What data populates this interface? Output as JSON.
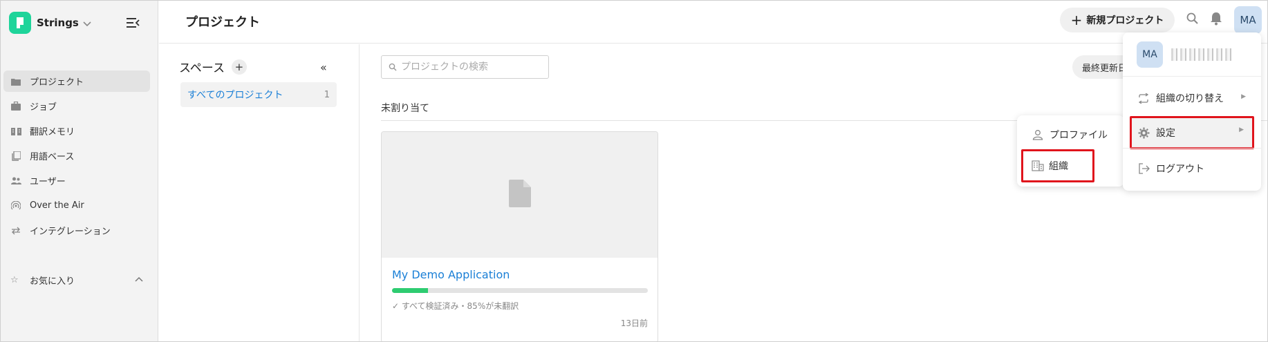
{
  "app": {
    "name": "Strings"
  },
  "sidebar": {
    "items": [
      {
        "label": "プロジェクト",
        "icon": "folder-icon",
        "active": true
      },
      {
        "label": "ジョブ",
        "icon": "briefcase-icon",
        "active": false
      },
      {
        "label": "翻訳メモリ",
        "icon": "book-icon",
        "active": false
      },
      {
        "label": "用語ベース",
        "icon": "glossary-icon",
        "active": false
      },
      {
        "label": "ユーザー",
        "icon": "users-icon",
        "active": false
      },
      {
        "label": "Over the Air",
        "icon": "broadcast-icon",
        "active": false
      },
      {
        "label": "インテグレーション",
        "icon": "arrows-icon",
        "active": false
      }
    ],
    "favorites": "お気に入り"
  },
  "header": {
    "title": "プロジェクト",
    "new_project": "新規プロジェクト",
    "avatar": "MA"
  },
  "spaces": {
    "title": "スペース",
    "all_projects": "すべてのプロジェクト",
    "all_count": "1"
  },
  "main": {
    "search_placeholder": "プロジェクトの検索",
    "sort_label": "最終更新日",
    "section": "未割り当て",
    "card": {
      "title": "My Demo Application",
      "progress": 0.14,
      "status": "✓ すべて検証済み・85%が未翻訳",
      "date": "13日前"
    }
  },
  "user_menu": {
    "avatar": "MA",
    "switch_org": "組織の切り替え",
    "settings": "設定",
    "logout": "ログアウト"
  },
  "settings_submenu": {
    "profile": "プロファイル",
    "organization": "組織"
  },
  "colors": {
    "brand": "#1ed49a",
    "link": "#1a7fd6",
    "highlight": "#e0141c",
    "progress": "#2ecc71"
  }
}
